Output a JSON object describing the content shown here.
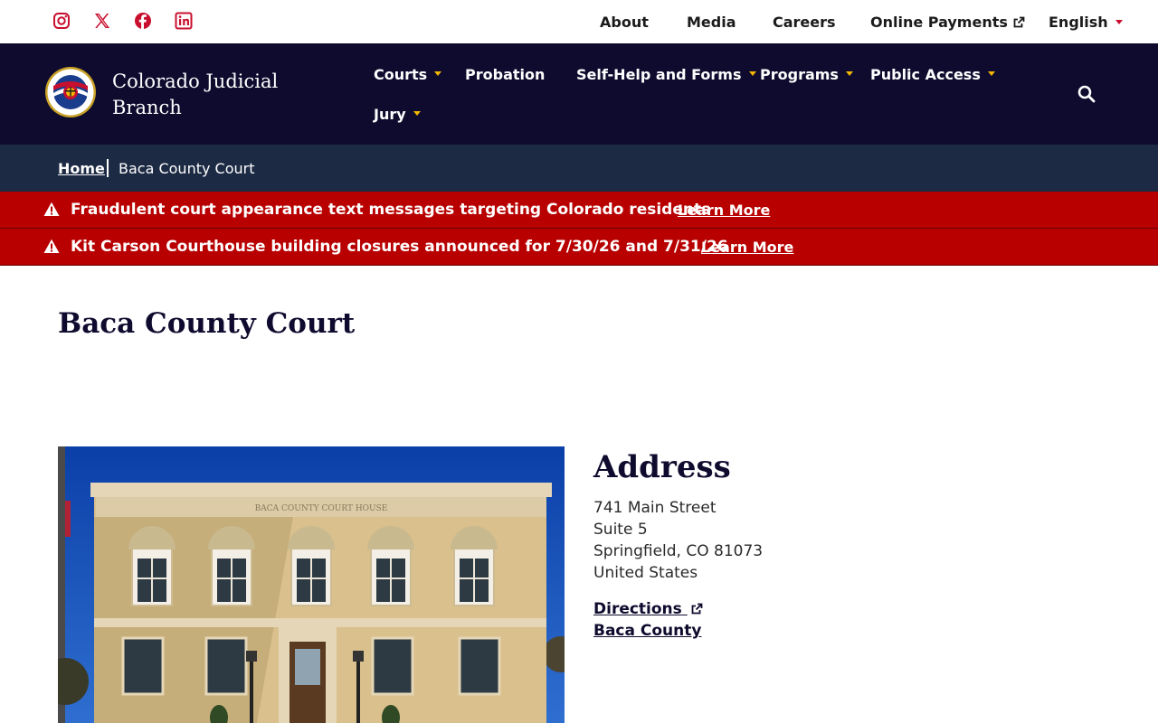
{
  "utility_nav": {
    "social": [
      "instagram-icon",
      "x-twitter-icon",
      "facebook-icon",
      "linkedin-icon"
    ],
    "links": [
      "About",
      "Media",
      "Careers",
      "Online Payments",
      "English"
    ]
  },
  "header": {
    "site_name_line1": "Colorado Judicial",
    "site_name_line2": "Branch",
    "nav": {
      "courts": "Courts",
      "probation": "Probation",
      "self_help": "Self-Help and Forms",
      "programs": "Programs",
      "public_access": "Public Access",
      "jury": "Jury"
    }
  },
  "breadcrumb": {
    "home": "Home",
    "current": "Baca County Court"
  },
  "alerts": [
    {
      "text": "Fraudulent court appearance text messages targeting Colorado residents",
      "link": "Learn More"
    },
    {
      "text": "Kit Carson Courthouse building closures announced for 7/30/26 and 7/31/26",
      "link": "Learn More"
    }
  ],
  "main": {
    "title": "Baca County Court",
    "photo_caption": "BACA COUNTY COURT HOUSE",
    "address": {
      "heading": "Address",
      "line1": "741 Main Street",
      "line2": "Suite 5",
      "line3": "Springfield, CO 81073",
      "line4": "United States",
      "directions": "Directions",
      "county_link": "Baca County"
    }
  },
  "colors": {
    "header_bg": "#0e0b2e",
    "breadcrumb_bg": "#1c2a44",
    "alert_bg": "#b80000",
    "accent_red": "#c8102e",
    "accent_gold": "#f2b705"
  }
}
